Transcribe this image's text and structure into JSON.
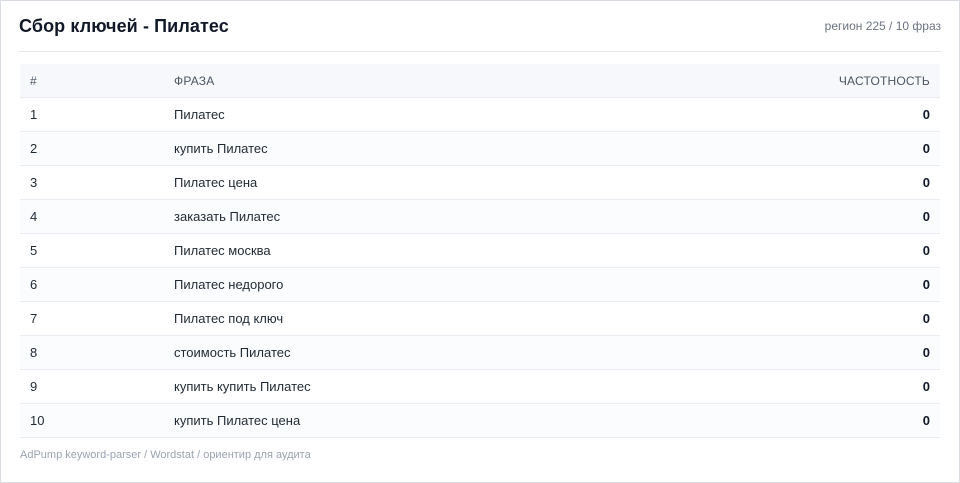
{
  "header": {
    "title": "Сбор ключей - Пилатес",
    "meta": "регион 225 / 10 фраз"
  },
  "table": {
    "columns": {
      "num": "#",
      "phrase": "ФРАЗА",
      "freq": "ЧАСТОТНОСТЬ"
    },
    "rows": [
      {
        "num": "1",
        "phrase": "Пилатес",
        "freq": "0"
      },
      {
        "num": "2",
        "phrase": "купить Пилатес",
        "freq": "0"
      },
      {
        "num": "3",
        "phrase": "Пилатес цена",
        "freq": "0"
      },
      {
        "num": "4",
        "phrase": "заказать Пилатес",
        "freq": "0"
      },
      {
        "num": "5",
        "phrase": "Пилатес москва",
        "freq": "0"
      },
      {
        "num": "6",
        "phrase": "Пилатес недорого",
        "freq": "0"
      },
      {
        "num": "7",
        "phrase": "Пилатес под ключ",
        "freq": "0"
      },
      {
        "num": "8",
        "phrase": "стоимость Пилатес",
        "freq": "0"
      },
      {
        "num": "9",
        "phrase": "купить купить Пилатес",
        "freq": "0"
      },
      {
        "num": "10",
        "phrase": "купить Пилатес цена",
        "freq": "0"
      }
    ]
  },
  "footer": {
    "text": "AdPump keyword-parser / Wordstat / ориентир для аудита"
  }
}
